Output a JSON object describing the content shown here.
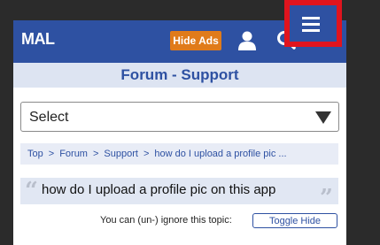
{
  "header": {
    "logo": "MAL",
    "hide_ads_label": "Hide Ads",
    "icons": [
      "user-icon",
      "search-icon",
      "menu-icon"
    ]
  },
  "page_title": "Forum - Support",
  "select": {
    "value": "Select"
  },
  "breadcrumb": {
    "items": [
      "Top",
      "Forum",
      "Support",
      "how do I upload a profile pic ..."
    ],
    "separator": ">"
  },
  "topic": {
    "title": "how do I upload a profile pic on this app",
    "quote_open": "“",
    "quote_close": "”"
  },
  "ignore": {
    "text": "You can (un-) ignore this topic:",
    "button_label": "Toggle Hide"
  },
  "colors": {
    "brand": "#2e51a2",
    "hide_ads": "#e07b1a",
    "highlight": "#e0141e",
    "title_bg": "#dde4f2"
  }
}
